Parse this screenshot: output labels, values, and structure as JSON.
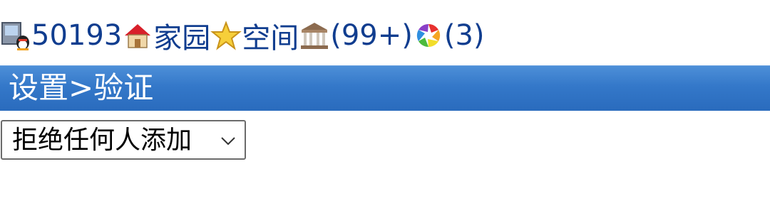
{
  "nav": {
    "user_id": "50193",
    "home_label": "家园",
    "space_label": "空间",
    "messages_count": "(99+)",
    "photos_count": "(3)"
  },
  "header": {
    "title": "设置>验证"
  },
  "verify_select": {
    "selected": "拒绝任何人添加"
  },
  "icons": {
    "user": "qq-user-icon",
    "home": "house-icon",
    "space": "star-icon",
    "messages": "building-icon",
    "photos": "aperture-icon"
  }
}
